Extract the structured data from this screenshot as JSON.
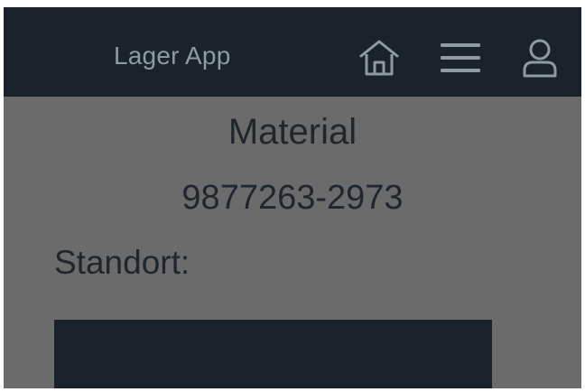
{
  "header": {
    "app_title": "Lager App",
    "icons": [
      "home-icon",
      "menu-icon",
      "user-icon"
    ]
  },
  "main": {
    "title": "Material",
    "material_number": "9877263-2973",
    "location_label": "Standort:"
  },
  "colors": {
    "header_bg": "#1b222b",
    "overlay_bg": "#6b6b6b",
    "text": "#1f262d",
    "icon": "#8f9aa3"
  }
}
